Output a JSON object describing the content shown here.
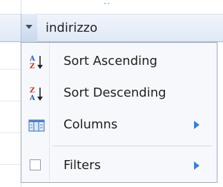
{
  "grid": {
    "column_header": "indirizzo"
  },
  "menu": {
    "items": [
      {
        "label": "Sort Ascending",
        "icon": "sort-ascending-icon",
        "has_submenu": false
      },
      {
        "label": "Sort Descending",
        "icon": "sort-descending-icon",
        "has_submenu": false
      },
      {
        "label": "Columns",
        "icon": "columns-icon",
        "has_submenu": true
      },
      {
        "label": "Filters",
        "icon": "checkbox-icon",
        "has_submenu": true,
        "checked": false
      }
    ]
  },
  "colors": {
    "submenu_arrow": "#3b7fd4",
    "menu_background": "#f6f8fb",
    "header_gradient_top": "#f1f5fb",
    "header_gradient_bottom": "#dfe8f5"
  }
}
